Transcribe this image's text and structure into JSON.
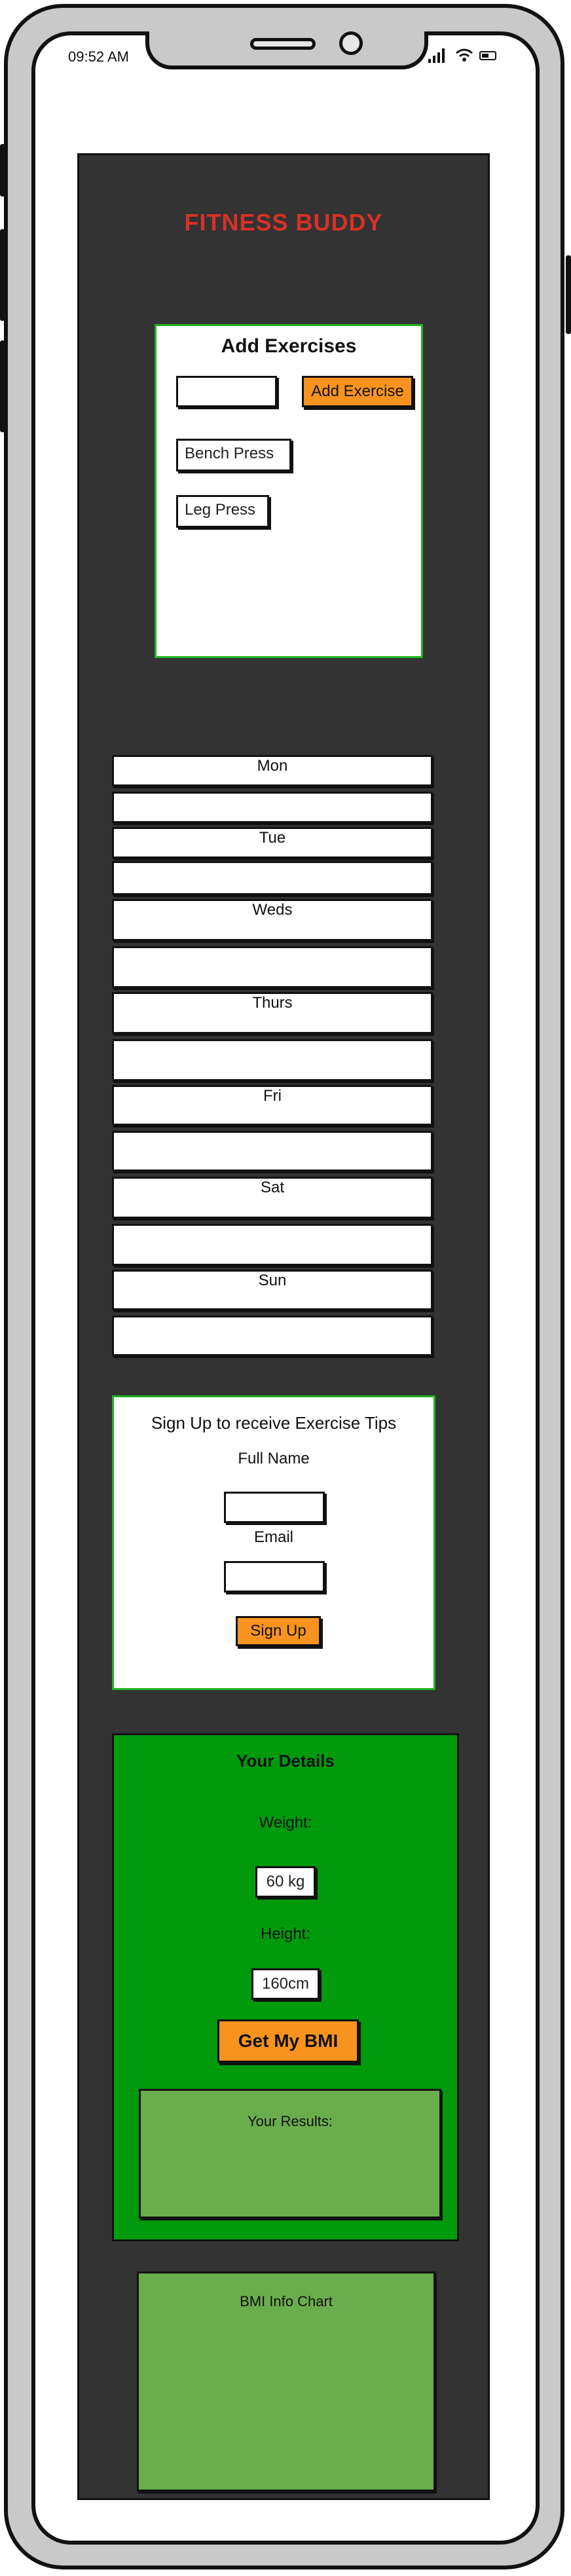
{
  "status_bar": {
    "time": "09:52 AM"
  },
  "icons": {
    "signal": "cellular-signal-icon",
    "wifi": "wifi-icon",
    "battery": "battery-icon"
  },
  "colors": {
    "app_background": "#333333",
    "title": "#d73027",
    "button": "#f7931e",
    "card_border": "#21b521",
    "details_background": "#009a0c",
    "results_background": "#6aad4c"
  },
  "app": {
    "title": "FITNESS BUDDY"
  },
  "add_exercises": {
    "heading": "Add Exercises",
    "input_value": "",
    "button_label": "Add Exercise",
    "items": [
      "Bench Press",
      "Leg Press"
    ]
  },
  "schedule": {
    "days": [
      "Mon",
      "Tue",
      "Weds",
      "Thurs",
      "Fri",
      "Sat",
      "Sun"
    ]
  },
  "signup": {
    "heading": "Sign Up to receive Exercise Tips",
    "name_label": "Full Name",
    "name_value": "",
    "email_label": "Email",
    "email_value": "",
    "button_label": "Sign Up"
  },
  "details": {
    "heading": "Your Details",
    "weight_label": "Weight:",
    "weight_value": "60 kg",
    "height_label": "Height:",
    "height_value": "160cm",
    "button_label": "Get My BMI",
    "results_label": "Your Results:"
  },
  "bmi_chart": {
    "label": "BMI Info Chart"
  }
}
